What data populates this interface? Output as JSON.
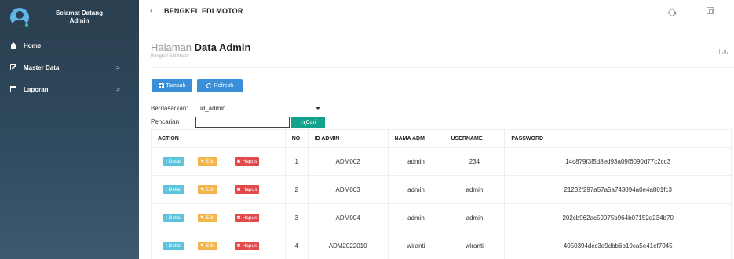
{
  "sidebar": {
    "user_greeting": "Selamat Datang",
    "user_role": "Admin",
    "items": [
      {
        "label": "Home",
        "icon": "home-icon",
        "has_submenu": false
      },
      {
        "label": "Master Data",
        "icon": "edit-icon",
        "has_submenu": true
      },
      {
        "label": "Laporan",
        "icon": "calendar-icon",
        "has_submenu": true
      }
    ]
  },
  "topbar": {
    "back_symbol": "‹",
    "title": "BENGKEL EDI MOTOR"
  },
  "page": {
    "title_light": "Halaman",
    "title_strong": "Data Admin",
    "subtitle": "Bengkel Edi Motor"
  },
  "actions": {
    "add_label": "Tambah",
    "refresh_label": "Refresh"
  },
  "filter": {
    "by_label": "Berdasarkan:",
    "by_value": "id_admin",
    "search_label": "Pencarian",
    "search_value": "",
    "search_button_label": "Cari"
  },
  "table": {
    "headers": [
      "ACTION",
      "NO",
      "ID ADMIN",
      "NAMA ADM",
      "USERNAME",
      "PASSWORD"
    ],
    "row_actions": {
      "detail": "Detail",
      "edit": "Edit",
      "hapus": "Hapus"
    },
    "rows": [
      {
        "no": "1",
        "id_admin": "ADM002",
        "nama": "admin",
        "username": "234",
        "password": "14c879f3f5d8ed93a09f6090d77c2cc3"
      },
      {
        "no": "2",
        "id_admin": "ADM003",
        "nama": "admin",
        "username": "admin",
        "password": "21232f297a57a5a743894a0e4a801fc3"
      },
      {
        "no": "3",
        "id_admin": "ADM004",
        "nama": "admin",
        "username": "admin",
        "password": "202cb962ac59075b964b07152d234b70"
      },
      {
        "no": "4",
        "id_admin": "ADM2022010",
        "nama": "wiranti",
        "username": "wiranti",
        "password": "4050394dcc3d9dbb6b19ca5e41ef7045"
      }
    ]
  },
  "colors": {
    "sidebar_bg": "#2a3f4f",
    "primary": "#3a8fd8",
    "success": "#12a18a",
    "info": "#5cc3dd",
    "warning": "#f3b54a",
    "danger": "#e14a4a"
  }
}
